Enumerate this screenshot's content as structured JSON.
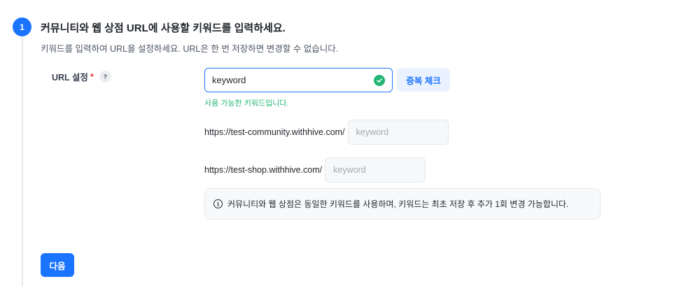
{
  "step": {
    "number": "1",
    "title": "커뮤니티와 웹 상점 URL에 사용할 키워드를 입력하세요.",
    "description": "키워드를 입력하여 URL을 설정하세요. URL은 한 번 저장하면 변경할 수 없습니다."
  },
  "url_setting": {
    "label": "URL 설정",
    "required_mark": "*",
    "help_icon_text": "?",
    "keyword_value": "keyword",
    "duplicate_check_label": "중복 체크",
    "success_message": "사용 가능한 키워드입니다.",
    "status_color": "#22b573"
  },
  "urls": {
    "community_prefix": "https://test-community.withhive.com/",
    "community_placeholder": "keyword",
    "shop_prefix": "https://test-shop.withhive.com/",
    "shop_placeholder": "keyword"
  },
  "notice": {
    "icon": "info-icon",
    "text": "커뮤니티와 웹 상점은 동일한 키워드를 사용하며, 키워드는 최초 저장 후 추가 1회 변경 가능합니다."
  },
  "actions": {
    "next_label": "다음"
  },
  "colors": {
    "accent": "#1b74ff",
    "success": "#22b573"
  }
}
